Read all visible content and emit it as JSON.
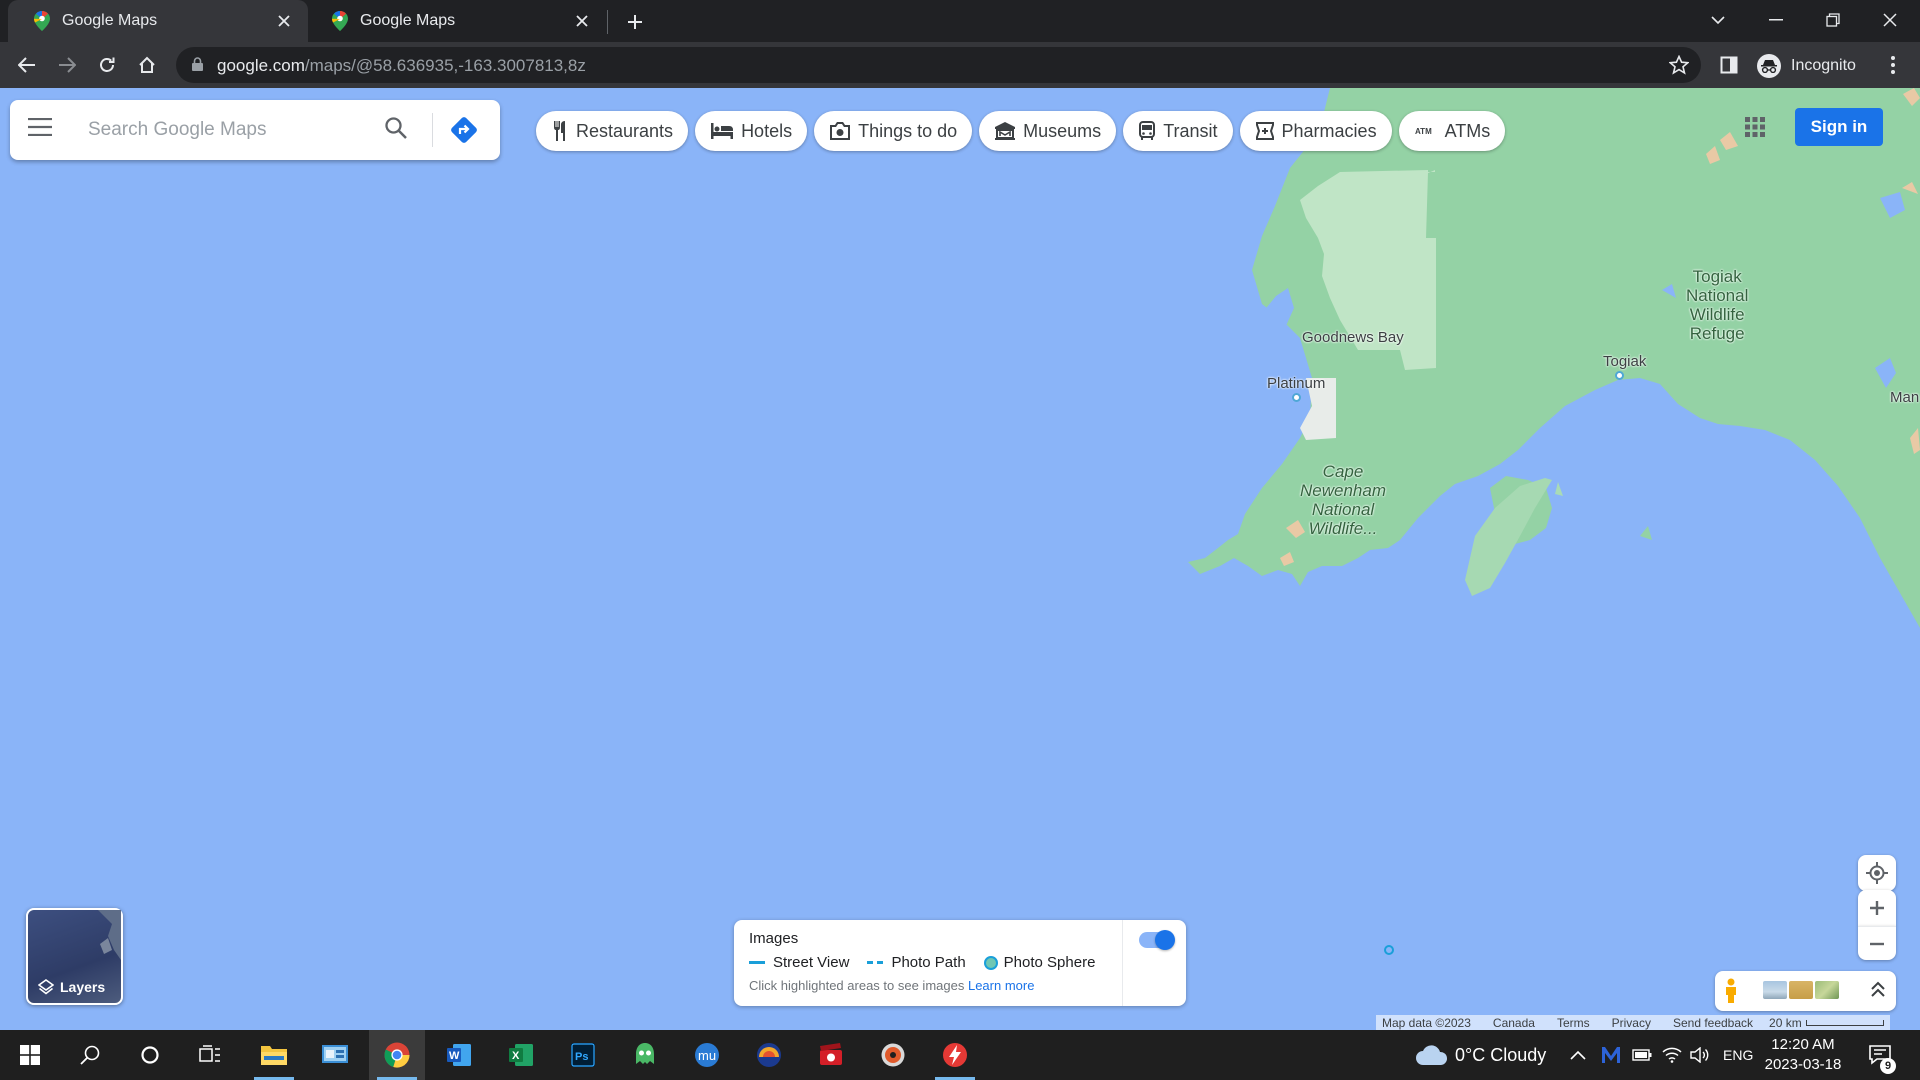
{
  "browser": {
    "tabs": [
      {
        "title": "Google Maps",
        "active": true
      },
      {
        "title": "Google Maps",
        "active": false
      }
    ],
    "url_host": "google.com",
    "url_path": "/maps/@58.636935,-163.3007813,8z",
    "profile_label": "Incognito"
  },
  "maps": {
    "search_placeholder": "Search Google Maps",
    "chips": [
      {
        "label": "Restaurants",
        "icon": "fork-knife-icon"
      },
      {
        "label": "Hotels",
        "icon": "bed-icon"
      },
      {
        "label": "Things to do",
        "icon": "camera-icon"
      },
      {
        "label": "Museums",
        "icon": "museum-icon"
      },
      {
        "label": "Transit",
        "icon": "bus-icon"
      },
      {
        "label": "Pharmacies",
        "icon": "pharmacy-icon"
      },
      {
        "label": "ATMs",
        "icon": "atm-icon"
      }
    ],
    "signin_label": "Sign in",
    "layers_label": "Layers",
    "place_labels": {
      "goodnews_bay": "Goodnews Bay",
      "platinum": "Platinum",
      "togiak": "Togiak",
      "mano": "Man",
      "togiak_refuge": [
        "Togiak",
        "National",
        "Wildlife",
        "Refuge"
      ],
      "cape_newenham": [
        "Cape",
        "Newenham",
        "National",
        "Wildlife..."
      ]
    },
    "images_panel": {
      "title": "Images",
      "legend": [
        "Street View",
        "Photo Path",
        "Photo Sphere"
      ],
      "hint": "Click highlighted areas to see images",
      "learn_more": "Learn more",
      "toggle_on": true
    },
    "attribution": {
      "map_data": "Map data ©2023",
      "region": "Canada",
      "terms": "Terms",
      "privacy": "Privacy",
      "feedback": "Send feedback",
      "scale": "20 km"
    },
    "colors": {
      "water": "#8ab4f8",
      "land": "#94d2a5",
      "park": "#c0e5c6",
      "accent": "#1a73e8"
    }
  },
  "taskbar": {
    "weather": "0°C  Cloudy",
    "language": "ENG",
    "time": "12:20 AM",
    "date": "2023-03-18",
    "notification_count": "9"
  }
}
